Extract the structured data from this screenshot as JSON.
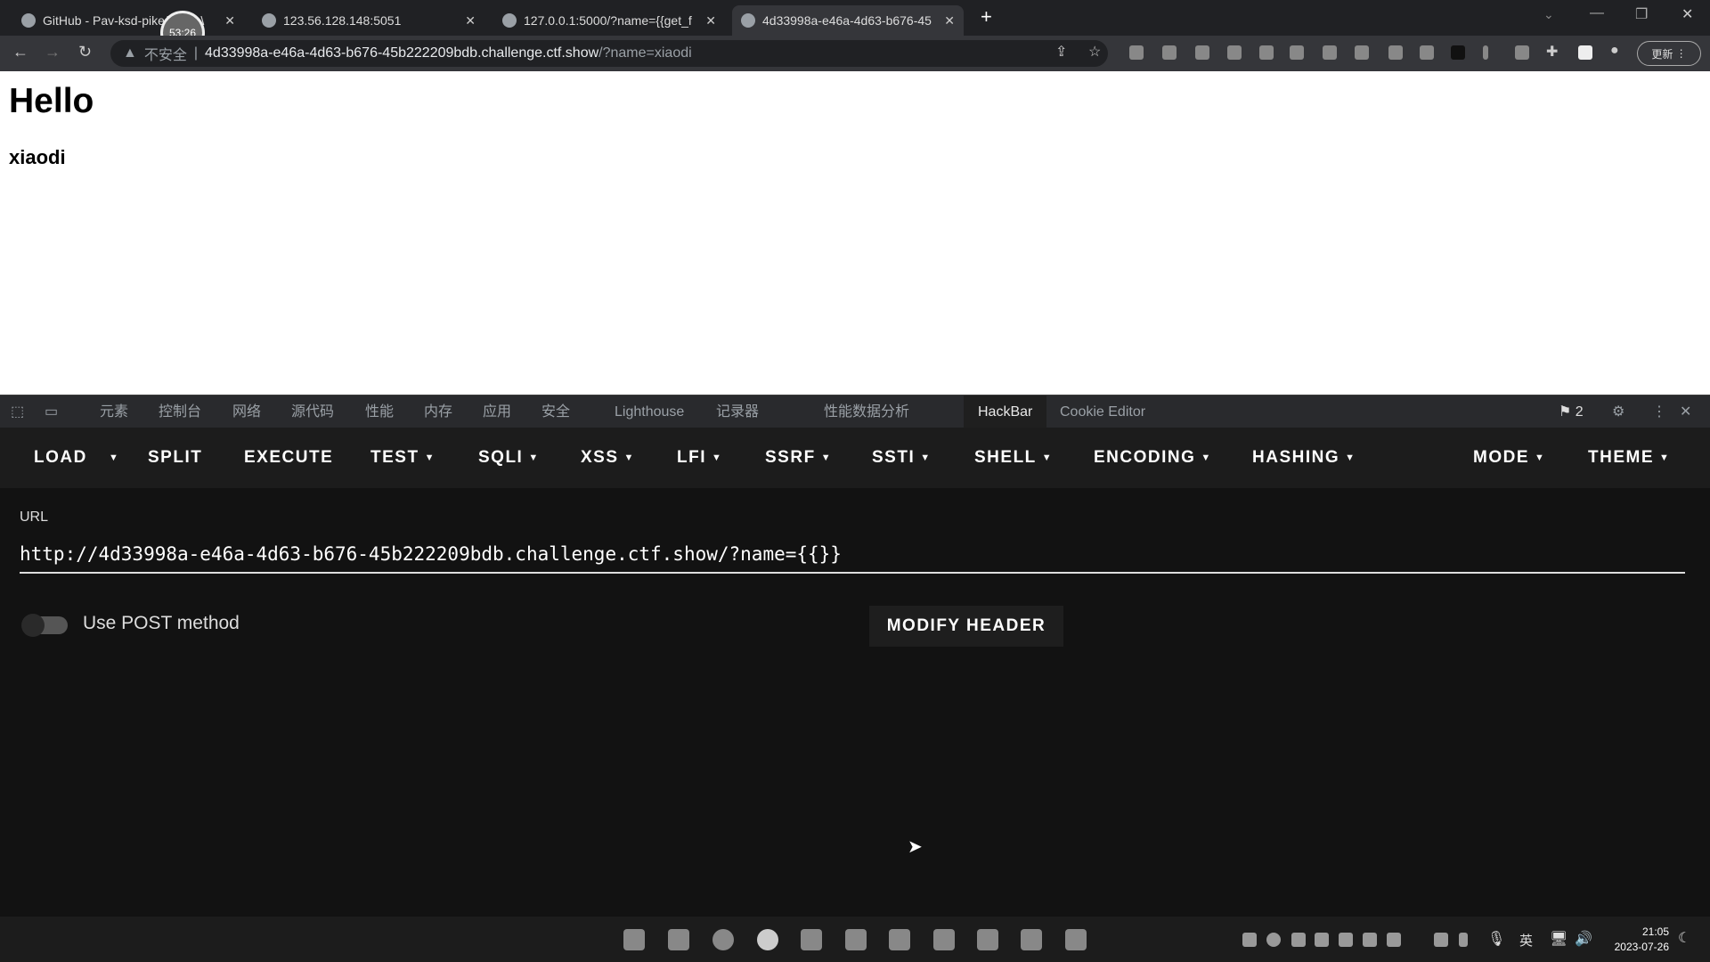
{
  "browser": {
    "tabs": [
      {
        "title": "GitHub - Pav-ksd-pike/Notes\\",
        "active": false
      },
      {
        "title": "123.56.128.148:5051",
        "active": false
      },
      {
        "title": "127.0.0.1:5000/?name={{get_f",
        "active": false
      },
      {
        "title": "4d33998a-e46a-4d63-b676-45",
        "active": true
      }
    ],
    "recording_timer": "53:26",
    "security_label": "不安全",
    "url_host": "4d33998a-e46a-4d63-b676-45b222209bdb.challenge.ctf.show",
    "url_path": "/?name=xiaodi",
    "update_label": "更新"
  },
  "page": {
    "heading": "Hello",
    "name": "xiaodi"
  },
  "devtools": {
    "tabs": [
      "元素",
      "控制台",
      "网络",
      "源代码",
      "性能",
      "内存",
      "应用",
      "安全",
      "Lighthouse",
      "记录器",
      "性能数据分析",
      "HackBar",
      "Cookie Editor"
    ],
    "active_tab": "HackBar",
    "issues_count": "2"
  },
  "hackbar": {
    "menu": [
      "LOAD",
      "SPLIT",
      "EXECUTE",
      "TEST",
      "SQLI",
      "XSS",
      "LFI",
      "SSRF",
      "SSTI",
      "SHELL",
      "ENCODING",
      "HASHING",
      "MODE",
      "THEME"
    ],
    "url_label": "URL",
    "url_value": "http://4d33998a-e46a-4d63-b676-45b222209bdb.challenge.ctf.show/?name={{}}",
    "post_label": "Use POST method",
    "post_enabled": false,
    "modify_header_label": "MODIFY HEADER"
  },
  "taskbar": {
    "ime": "英",
    "time": "21:05",
    "date": "2023-07-26"
  }
}
